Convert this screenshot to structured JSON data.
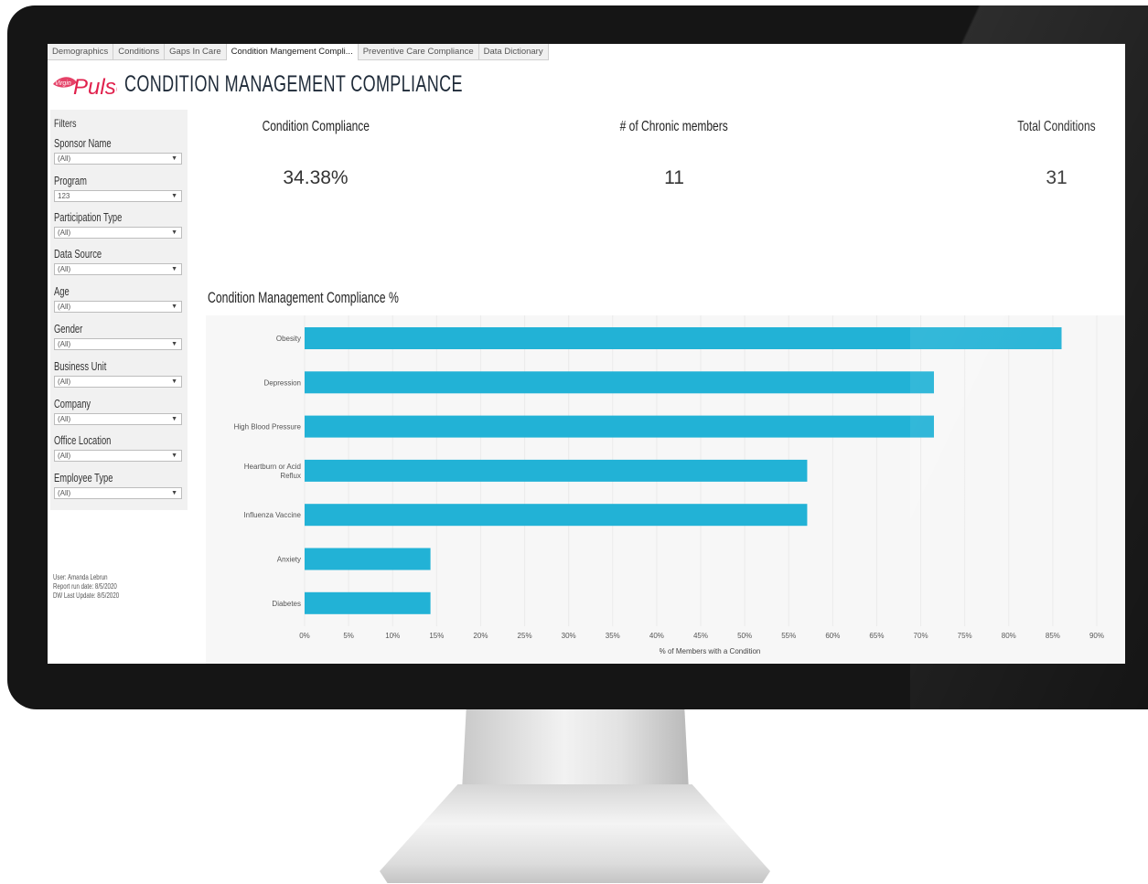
{
  "tabs": [
    {
      "label": "Demographics",
      "active": false
    },
    {
      "label": "Conditions",
      "active": false
    },
    {
      "label": "Gaps In Care",
      "active": false
    },
    {
      "label": "Condition Mangement Compli...",
      "active": true
    },
    {
      "label": "Preventive Care Compliance",
      "active": false
    },
    {
      "label": "Data Dictionary",
      "active": false
    }
  ],
  "brand": {
    "script_top": "Virgin",
    "script_main": "Pulse",
    "color": "#e0204c"
  },
  "page_title": "CONDITION MANAGEMENT COMPLIANCE",
  "filters": {
    "heading": "Filters",
    "items": [
      {
        "label": "Sponsor Name",
        "value": "(All)"
      },
      {
        "label": "Program",
        "value": "123"
      },
      {
        "label": "Participation Type",
        "value": "(All)"
      },
      {
        "label": "Data Source",
        "value": "(All)"
      },
      {
        "label": "Age",
        "value": "(All)"
      },
      {
        "label": "Gender",
        "value": "(All)"
      },
      {
        "label": "Business Unit",
        "value": "(All)"
      },
      {
        "label": "Company",
        "value": "(All)"
      },
      {
        "label": "Office Location",
        "value": "(All)"
      },
      {
        "label": "Employee Type",
        "value": "(All)"
      }
    ]
  },
  "report_info": {
    "user": "User: Amanda Lebrun",
    "run_date": "Report run date: 8/5/2020",
    "dw_update": "DW Last Update: 8/5/2020"
  },
  "kpis": [
    {
      "label": "Condition Compliance",
      "value": "34.38%"
    },
    {
      "label": "# of Chronic members",
      "value": "11"
    },
    {
      "label": "Total Conditions",
      "value": "31"
    }
  ],
  "chart_title": "Condition Management Compliance %",
  "chart_data": {
    "type": "bar",
    "orientation": "horizontal",
    "categories": [
      "Obesity",
      "Depression",
      "High Blood Pressure",
      "Heartburn or Acid Reflux",
      "Influenza Vaccine",
      "Anxiety",
      "Diabetes"
    ],
    "category_lines": [
      [
        "Obesity"
      ],
      [
        "Depression"
      ],
      [
        "High Blood Pressure"
      ],
      [
        "Heartburn or Acid",
        "Reflux"
      ],
      [
        "Influenza Vaccine"
      ],
      [
        "Anxiety"
      ],
      [
        "Diabetes"
      ]
    ],
    "values": [
      86,
      71.5,
      71.5,
      57.1,
      57.1,
      14.3,
      14.3
    ],
    "xlabel": "% of Members with a Condition",
    "xlim": [
      0,
      90
    ],
    "xticks": [
      "0%",
      "5%",
      "10%",
      "15%",
      "20%",
      "25%",
      "30%",
      "35%",
      "40%",
      "45%",
      "50%",
      "55%",
      "60%",
      "65%",
      "70%",
      "75%",
      "80%",
      "85%",
      "90%"
    ],
    "bar_color": "#22b2d6",
    "grid": true
  }
}
